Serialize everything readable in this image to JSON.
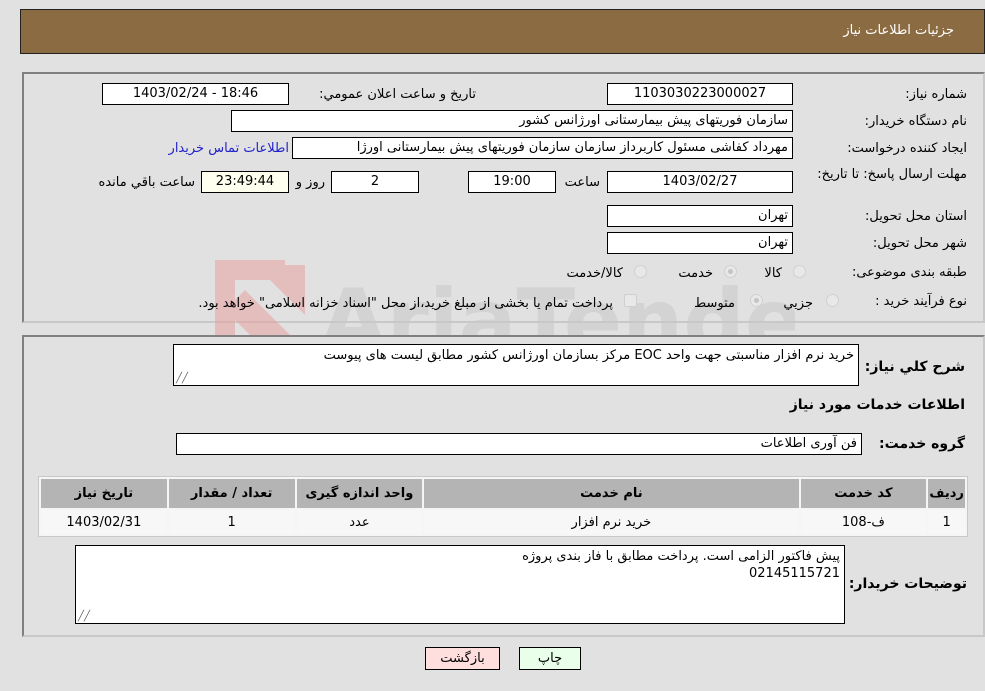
{
  "header": {
    "title": "جزئیات اطلاعات نیاز"
  },
  "form": {
    "need_number": {
      "label": "شماره نیاز:",
      "value": "1103030223000027"
    },
    "announce_datetime": {
      "label": "تاریخ و ساعت اعلان عمومي:",
      "value": "1403/02/24 - 18:46"
    },
    "buyer_org": {
      "label": "نام دستگاه خريدار:",
      "value": "سازمان فوریتهای پیش بیمارستانی اورژانس کشور"
    },
    "requester": {
      "label": "ايجاد کننده درخواست:",
      "value": "مهرداد کفاشی مسئول کاربرداز سازمان سازمان فوریتهای پیش بیمارستانی اورژا",
      "contact_link": "اطلاعات تماس خريدار"
    },
    "deadline": {
      "label": "مهلت ارسال پاسخ: تا تاریخ:",
      "date": "1403/02/27",
      "time_label": "ساعت",
      "time": "19:00",
      "days": "2",
      "days_label": "روز و",
      "remaining": "23:49:44",
      "remaining_label": "ساعت باقي مانده"
    },
    "province": {
      "label": "استان محل تحويل:",
      "value": "تهران"
    },
    "city": {
      "label": "شهر محل تحويل:",
      "value": "تهران"
    },
    "category": {
      "label": "طبقه بندی موضوعی:",
      "options": [
        "کالا",
        "خدمت",
        "کالا/خدمت"
      ],
      "selected": "خدمت"
    },
    "purchase_type": {
      "label": "نوع فرآيند خريد :",
      "options": [
        "جزيي",
        "متوسط"
      ],
      "selected": "متوسط",
      "treasury_note": "پرداخت تمام يا بخشی از مبلغ خريد،از محل \"اسناد خزانه اسلامی\" خواهد بود.",
      "treasury_checked": false
    }
  },
  "description": {
    "label": "شرح کلي نياز:",
    "value": "خرید نرم افزار مناسبتی جهت واحد EOC مرکز بسازمان اورژانس کشور مطابق لیست های پیوست"
  },
  "services_section": {
    "title": "اطلاعات خدمات مورد نياز",
    "group_label": "گروه خدمت:",
    "group_value": "فن آوری اطلاعات"
  },
  "table": {
    "headers": [
      "رديف",
      "کد خدمت",
      "نام خدمت",
      "واحد اندازه گيری",
      "تعداد / مقدار",
      "تاريخ نياز"
    ],
    "rows": [
      [
        "1",
        "ف-108",
        "خريد نرم افزار",
        "عدد",
        "1",
        "1403/02/31"
      ]
    ]
  },
  "buyer_notes": {
    "label": "توضيحات خريدار:",
    "line1": "پیش فاکتور الزامی است. پرداخت مطابق با فاز بندی پروژه",
    "line2": "02145115721"
  },
  "buttons": {
    "print": "چاپ",
    "back": "بازگشت"
  },
  "watermark": {
    "text": "AriaTender.neT"
  }
}
